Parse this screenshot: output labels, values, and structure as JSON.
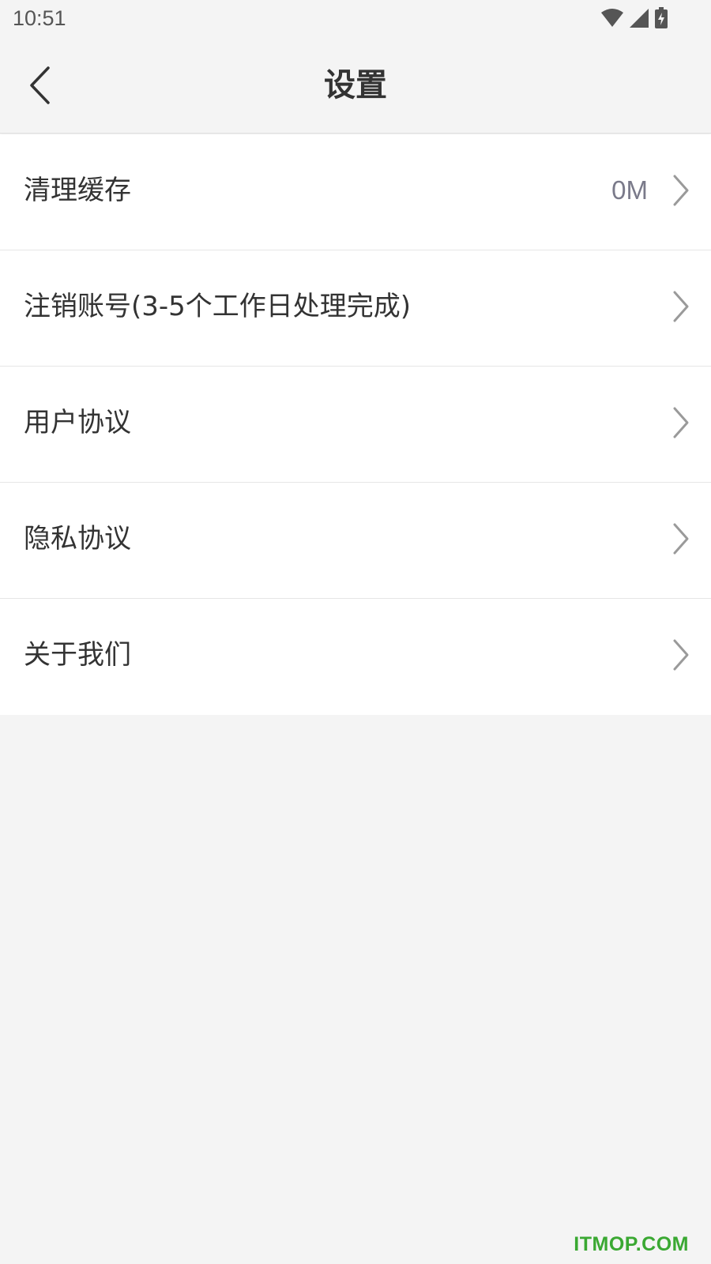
{
  "status_bar": {
    "time": "10:51",
    "icons": [
      "wifi-icon",
      "signal-icon",
      "battery-charging-icon"
    ]
  },
  "nav": {
    "title": "设置",
    "back_icon": "back-arrow-icon"
  },
  "settings": {
    "items": [
      {
        "label": "清理缓存",
        "value": "0M"
      },
      {
        "label": "注销账号(3-5个工作日处理完成)"
      },
      {
        "label": "用户协议"
      },
      {
        "label": "隐私协议"
      },
      {
        "label": "关于我们"
      }
    ]
  },
  "watermark": "ITMOP.COM",
  "colors": {
    "background": "#f4f4f4",
    "row_background": "#ffffff",
    "text": "#333333",
    "secondary_text": "#7a7a8a",
    "chevron": "#9a9a9a",
    "watermark": "#3aa832"
  }
}
